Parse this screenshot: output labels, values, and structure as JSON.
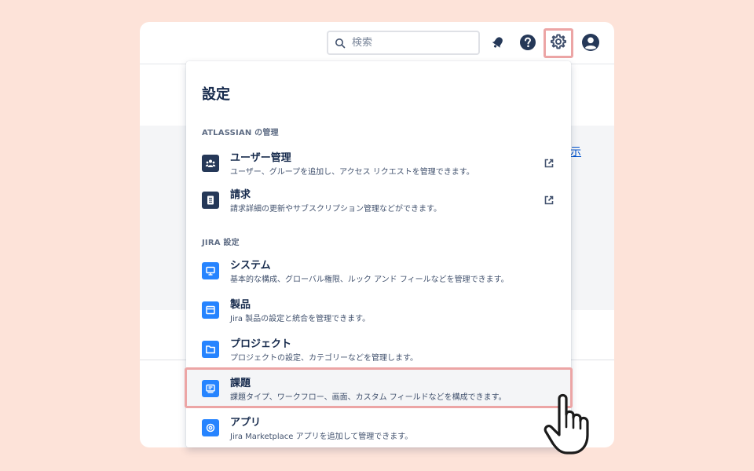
{
  "header": {
    "search": {
      "placeholder": "検索",
      "value": ""
    },
    "icons": [
      "search-icon",
      "bell-icon",
      "help-icon",
      "gear-icon",
      "avatar-icon"
    ]
  },
  "background": {
    "link_text": "示"
  },
  "settings_menu": {
    "title": "設定",
    "sections": [
      {
        "heading": "ATLASSIAN の管理",
        "items": [
          {
            "name": "ユーザー管理",
            "desc": "ユーザー、グループを追加し、アクセス リクエストを管理できます。",
            "icon": "people-icon",
            "external": true
          },
          {
            "name": "請求",
            "desc": "請求詳細の更新やサブスクリプション管理などができます。",
            "icon": "document-icon",
            "external": true
          }
        ]
      },
      {
        "heading": "JIRA 設定",
        "items": [
          {
            "name": "システム",
            "desc": "基本的な構成、グローバル権限、ルック アンド フィールなどを管理できます。",
            "icon": "monitor-icon"
          },
          {
            "name": "製品",
            "desc": "Jira 製品の設定と統合を管理できます。",
            "icon": "window-icon"
          },
          {
            "name": "プロジェクト",
            "desc": "プロジェクトの設定、カテゴリーなどを管理します。",
            "icon": "folder-icon"
          },
          {
            "name": "課題",
            "desc": "課題タイプ、ワークフロー、画面、カスタム フィールドなどを構成できます。",
            "icon": "issue-icon",
            "highlighted": true
          },
          {
            "name": "アプリ",
            "desc": "Jira Marketplace アプリを追加して管理できます。",
            "icon": "app-icon"
          }
        ]
      }
    ]
  },
  "colors": {
    "page_bg": "#fde3d9",
    "highlight": "#eca5a5",
    "icon_dark": "#253858",
    "icon_blue": "#2684ff",
    "text": "#172b4d"
  }
}
